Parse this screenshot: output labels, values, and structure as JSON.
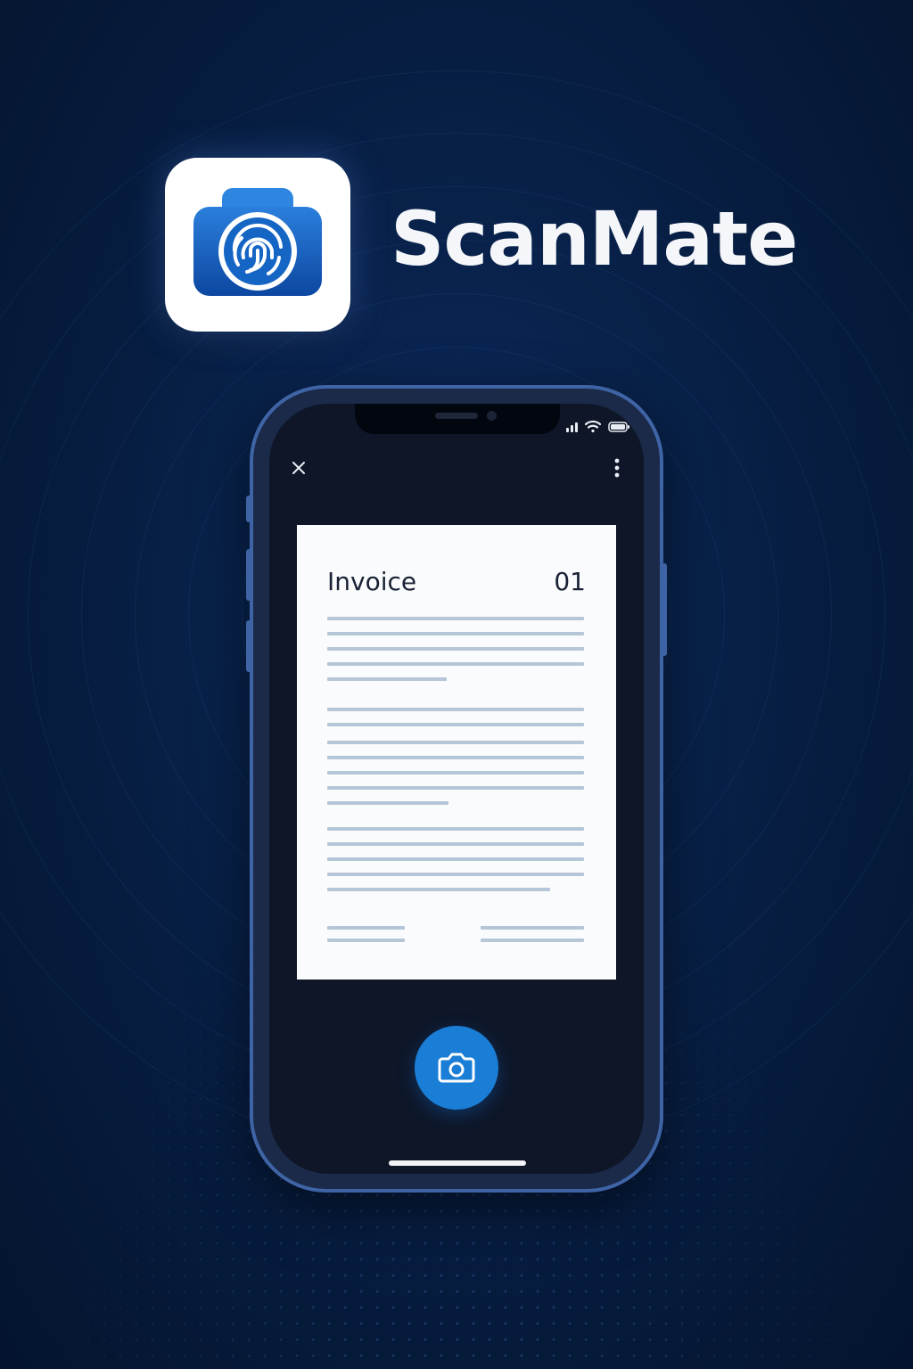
{
  "brand": {
    "app_name": "ScanMate",
    "accent_color": "#1a7ed6",
    "logo_icon": "camera-fingerprint-icon"
  },
  "phone": {
    "status_bar": {
      "icons": [
        "signal-icon",
        "wifi-icon",
        "battery-icon"
      ]
    },
    "top_bar": {
      "close_icon": "close-icon",
      "menu_icon": "more-vertical-icon"
    },
    "document": {
      "title": "Invoice",
      "number": "01"
    },
    "capture_button": {
      "icon": "camera-icon"
    }
  }
}
